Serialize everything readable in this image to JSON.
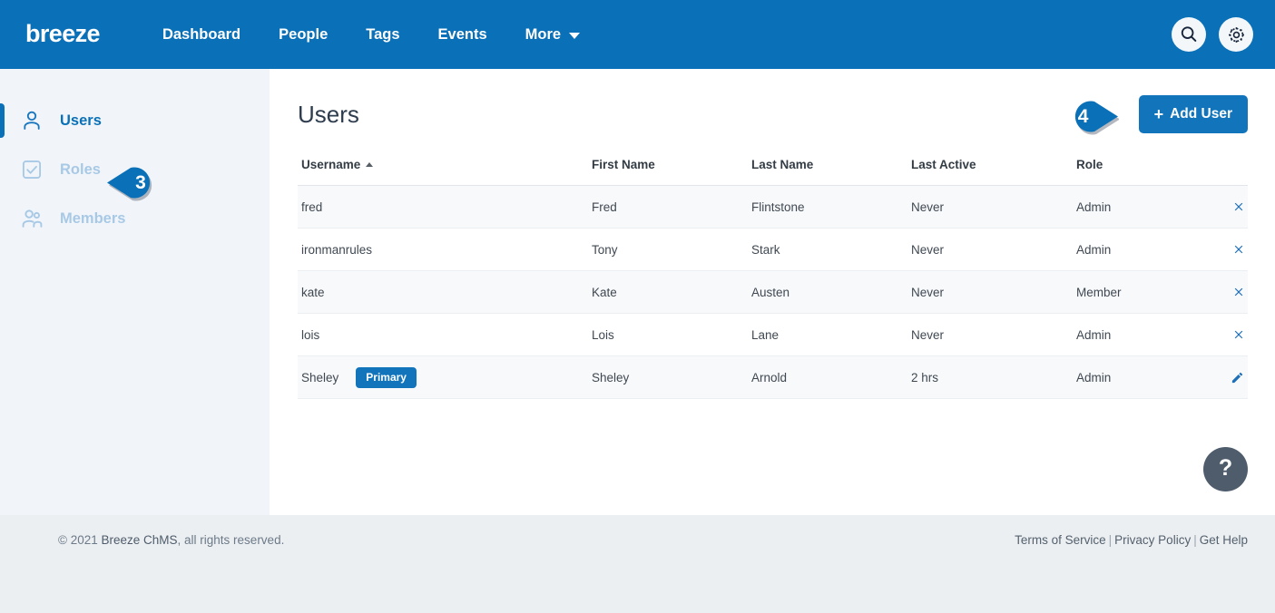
{
  "brand": {
    "logo_text": "breeze",
    "accent": "#0a70b7",
    "accent_button": "#1275bb"
  },
  "topnav": {
    "links": [
      {
        "label": "Dashboard"
      },
      {
        "label": "People"
      },
      {
        "label": "Tags"
      },
      {
        "label": "Events"
      },
      {
        "label": "More",
        "has_caret": true
      }
    ],
    "search_icon": "search-icon",
    "settings_icon": "gear-icon"
  },
  "sidebar": {
    "items": [
      {
        "label": "Users",
        "icon": "user-icon",
        "active": true
      },
      {
        "label": "Roles",
        "icon": "checkbox-icon",
        "active": false
      },
      {
        "label": "Members",
        "icon": "people-icon",
        "active": false
      }
    ]
  },
  "main": {
    "title": "Users",
    "add_user_label": "Add User",
    "add_user_plus": "+",
    "help_label": "?"
  },
  "table": {
    "columns": [
      {
        "label": "Username",
        "sorted": "asc"
      },
      {
        "label": "First Name"
      },
      {
        "label": "Last Name"
      },
      {
        "label": "Last Active"
      },
      {
        "label": "Role"
      }
    ],
    "rows": [
      {
        "username": "fred",
        "badge": "",
        "first": "Fred",
        "last": "Flintstone",
        "active": "Never",
        "role": "Admin",
        "can_delete": true
      },
      {
        "username": "ironmanrules",
        "badge": "",
        "first": "Tony",
        "last": "Stark",
        "active": "Never",
        "role": "Admin",
        "can_delete": true
      },
      {
        "username": "kate",
        "badge": "",
        "first": "Kate",
        "last": "Austen",
        "active": "Never",
        "role": "Member",
        "can_delete": true
      },
      {
        "username": "lois",
        "badge": "",
        "first": "Lois",
        "last": "Lane",
        "active": "Never",
        "role": "Admin",
        "can_delete": true
      },
      {
        "username": "Sheley",
        "badge": "Primary",
        "first": "Sheley",
        "last": "Arnold",
        "active": "2 hrs",
        "role": "Admin",
        "can_delete": false
      }
    ]
  },
  "footer": {
    "copyright_pre": "© 2021 ",
    "copyright_brand": "Breeze ChMS",
    "copyright_post": ", all rights reserved.",
    "links": [
      {
        "label": "Terms of Service"
      },
      {
        "label": "Privacy Policy"
      },
      {
        "label": "Get Help"
      }
    ],
    "separator": "|"
  },
  "annotations": [
    {
      "number": "3",
      "points": "left",
      "target": "sidebar-item-users"
    },
    {
      "number": "4",
      "points": "right",
      "target": "add-user-button"
    }
  ]
}
